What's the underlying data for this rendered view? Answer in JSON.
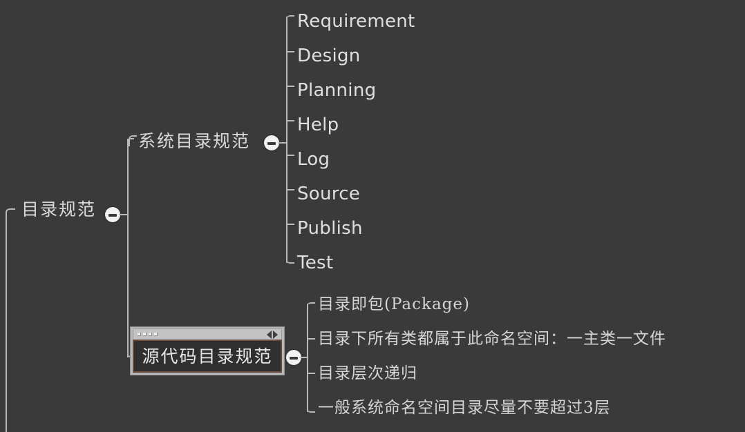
{
  "canvas": {
    "background": "#3a3a3a",
    "line_color": "#b9b9b9",
    "text_color": "#dcdcdc",
    "accent_border": "#6b4a42"
  },
  "mindmap": {
    "root": {
      "label": "目录规范",
      "toggle_icon": "minus-circle-icon",
      "toggle_state": "expanded"
    },
    "branches": [
      {
        "label": "系统目录规范",
        "toggle_icon": "minus-circle-icon",
        "toggle_state": "expanded",
        "children": [
          {
            "label": "Requirement"
          },
          {
            "label": "Design"
          },
          {
            "label": "Planning"
          },
          {
            "label": "Help"
          },
          {
            "label": "Log"
          },
          {
            "label": "Source"
          },
          {
            "label": "Publish"
          },
          {
            "label": "Test"
          }
        ]
      },
      {
        "label": "源代码目录规范",
        "selected": true,
        "toggle_icon": "minus-circle-icon",
        "toggle_state": "expanded",
        "titlebar": {
          "grip_icon": "grip-dots-icon",
          "left_arrow_icon": "arrow-left-icon",
          "right_arrow_icon": "arrow-right-icon"
        },
        "children": [
          {
            "label": "目录即包(Package)"
          },
          {
            "label": "目录下所有类都属于此命名空间：一主类一文件"
          },
          {
            "label": "目录层次递归"
          },
          {
            "label": "一般系统命名空间目录尽量不要超过3层"
          }
        ]
      }
    ]
  }
}
